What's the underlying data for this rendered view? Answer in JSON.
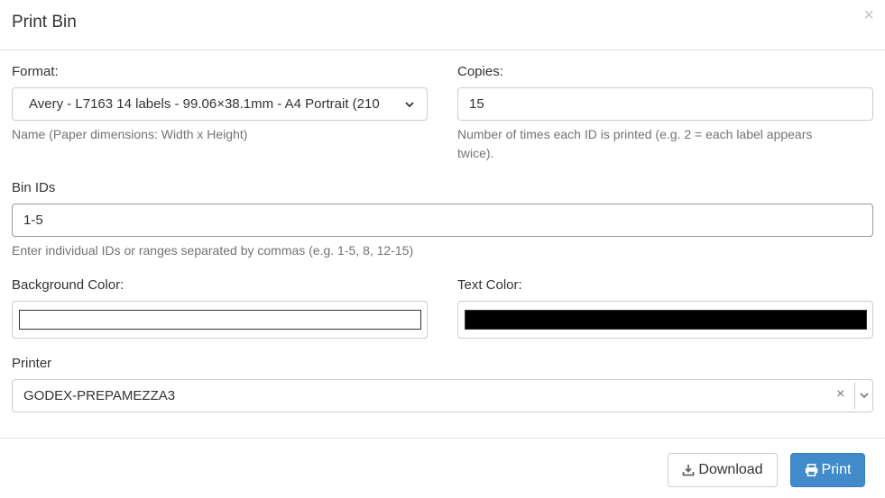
{
  "modal": {
    "title": "Print Bin",
    "close_symbol": "×"
  },
  "format": {
    "label": "Format:",
    "value": "Avery - L7163 14 labels - 99.06×38.1mm - A4 Portrait (210",
    "help": "Name (Paper dimensions: Width x Height)"
  },
  "copies": {
    "label": "Copies:",
    "value": "15",
    "help_line1": "Number of times each ID is printed (e.g. 2 = each label appears",
    "help_line2": "twice)."
  },
  "bin_ids": {
    "label": "Bin IDs",
    "value": "1-5",
    "help": "Enter individual IDs or ranges separated by commas (e.g. 1-5, 8, 12-15)"
  },
  "background_color": {
    "label": "Background Color:",
    "color": "#ffffff"
  },
  "text_color": {
    "label": "Text Color:",
    "color": "#000000"
  },
  "printer": {
    "label": "Printer",
    "value": "GODEX-PREPAMEZZA3",
    "clear_symbol": "×"
  },
  "footer": {
    "download_label": "Download",
    "print_label": "Print"
  },
  "icons": [
    "close-icon",
    "chevron-down-icon",
    "clear-icon",
    "download-icon",
    "print-icon"
  ]
}
